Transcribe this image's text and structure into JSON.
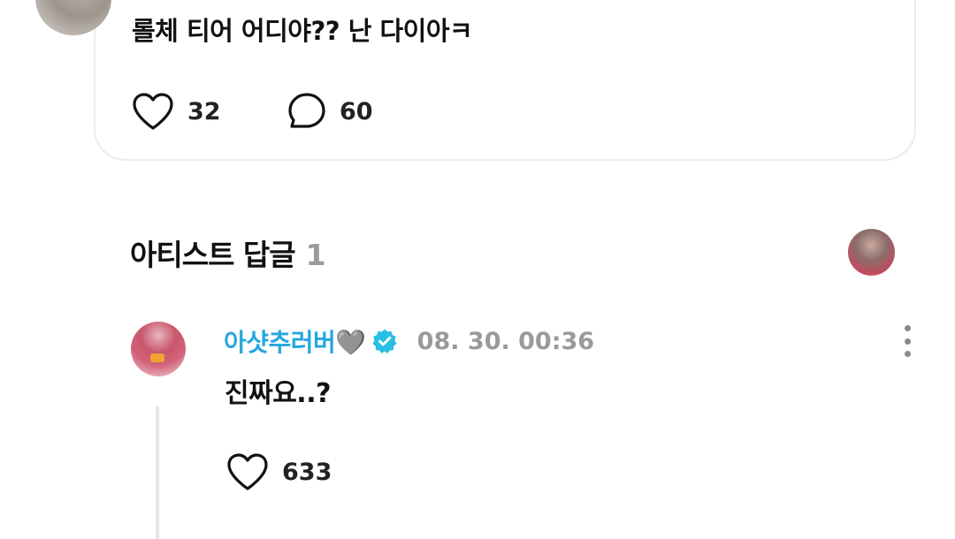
{
  "post": {
    "text": "롤체 티어 어디야?? 난 다이아ㅋ",
    "likes": "32",
    "comments": "60"
  },
  "artist_replies": {
    "title": "아티스트 답글",
    "count": "1"
  },
  "reply": {
    "author": "아샷추러버🩶",
    "timestamp": "08. 30. 00:36",
    "text": "진짜요..?",
    "likes": "633"
  },
  "colors": {
    "author_accent": "#26a7de",
    "verified_badge": "#27bfe3",
    "muted": "#9a9a9a"
  },
  "icons": {
    "like": "heart-outline-icon",
    "comment": "speech-bubble-icon",
    "verified": "verified-badge-icon",
    "more": "more-vertical-icon"
  }
}
